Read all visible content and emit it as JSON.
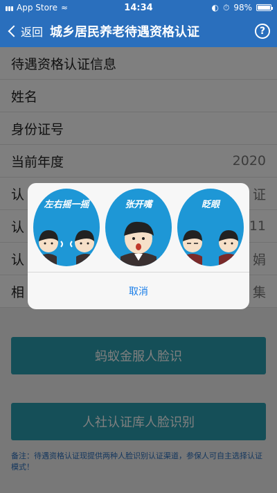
{
  "status_bar": {
    "carrier": "App Store",
    "time": "14:34",
    "battery": "98%"
  },
  "nav": {
    "back_label": "返回",
    "title": "城乡居民养老待遇资格认证",
    "help_label": "?"
  },
  "info_rows": [
    {
      "label": "待遇资格认证信息",
      "value": ""
    },
    {
      "label": "姓名",
      "value": ""
    },
    {
      "label": "身份证号",
      "value": ""
    },
    {
      "label": "当前年度",
      "value": "2020"
    },
    {
      "label": "认",
      "value": "证"
    },
    {
      "label": "认",
      "value": "11"
    },
    {
      "label": "认",
      "value": "娟"
    },
    {
      "label": "相",
      "value": "集"
    }
  ],
  "buttons": {
    "ant_face": "蚂蚁金服人脸识",
    "social_face": "人社认证库人脸识别"
  },
  "note": "备注：待遇资格认证现提供两种人脸识别认证渠道，参保人可自主选择认证模式！",
  "dialog": {
    "faces": [
      {
        "caption": "左右摇一摇",
        "icon": "shake-head-face-icon"
      },
      {
        "caption": "张开嘴",
        "icon": "open-mouth-face-icon"
      },
      {
        "caption": "眨眼",
        "icon": "blink-eyes-face-icon"
      }
    ],
    "cancel_label": "取消"
  },
  "colors": {
    "nav": "#2a6fbd",
    "button": "#2a9fb0",
    "face_bg": "#1e97d6",
    "link": "#1a7ee8"
  }
}
